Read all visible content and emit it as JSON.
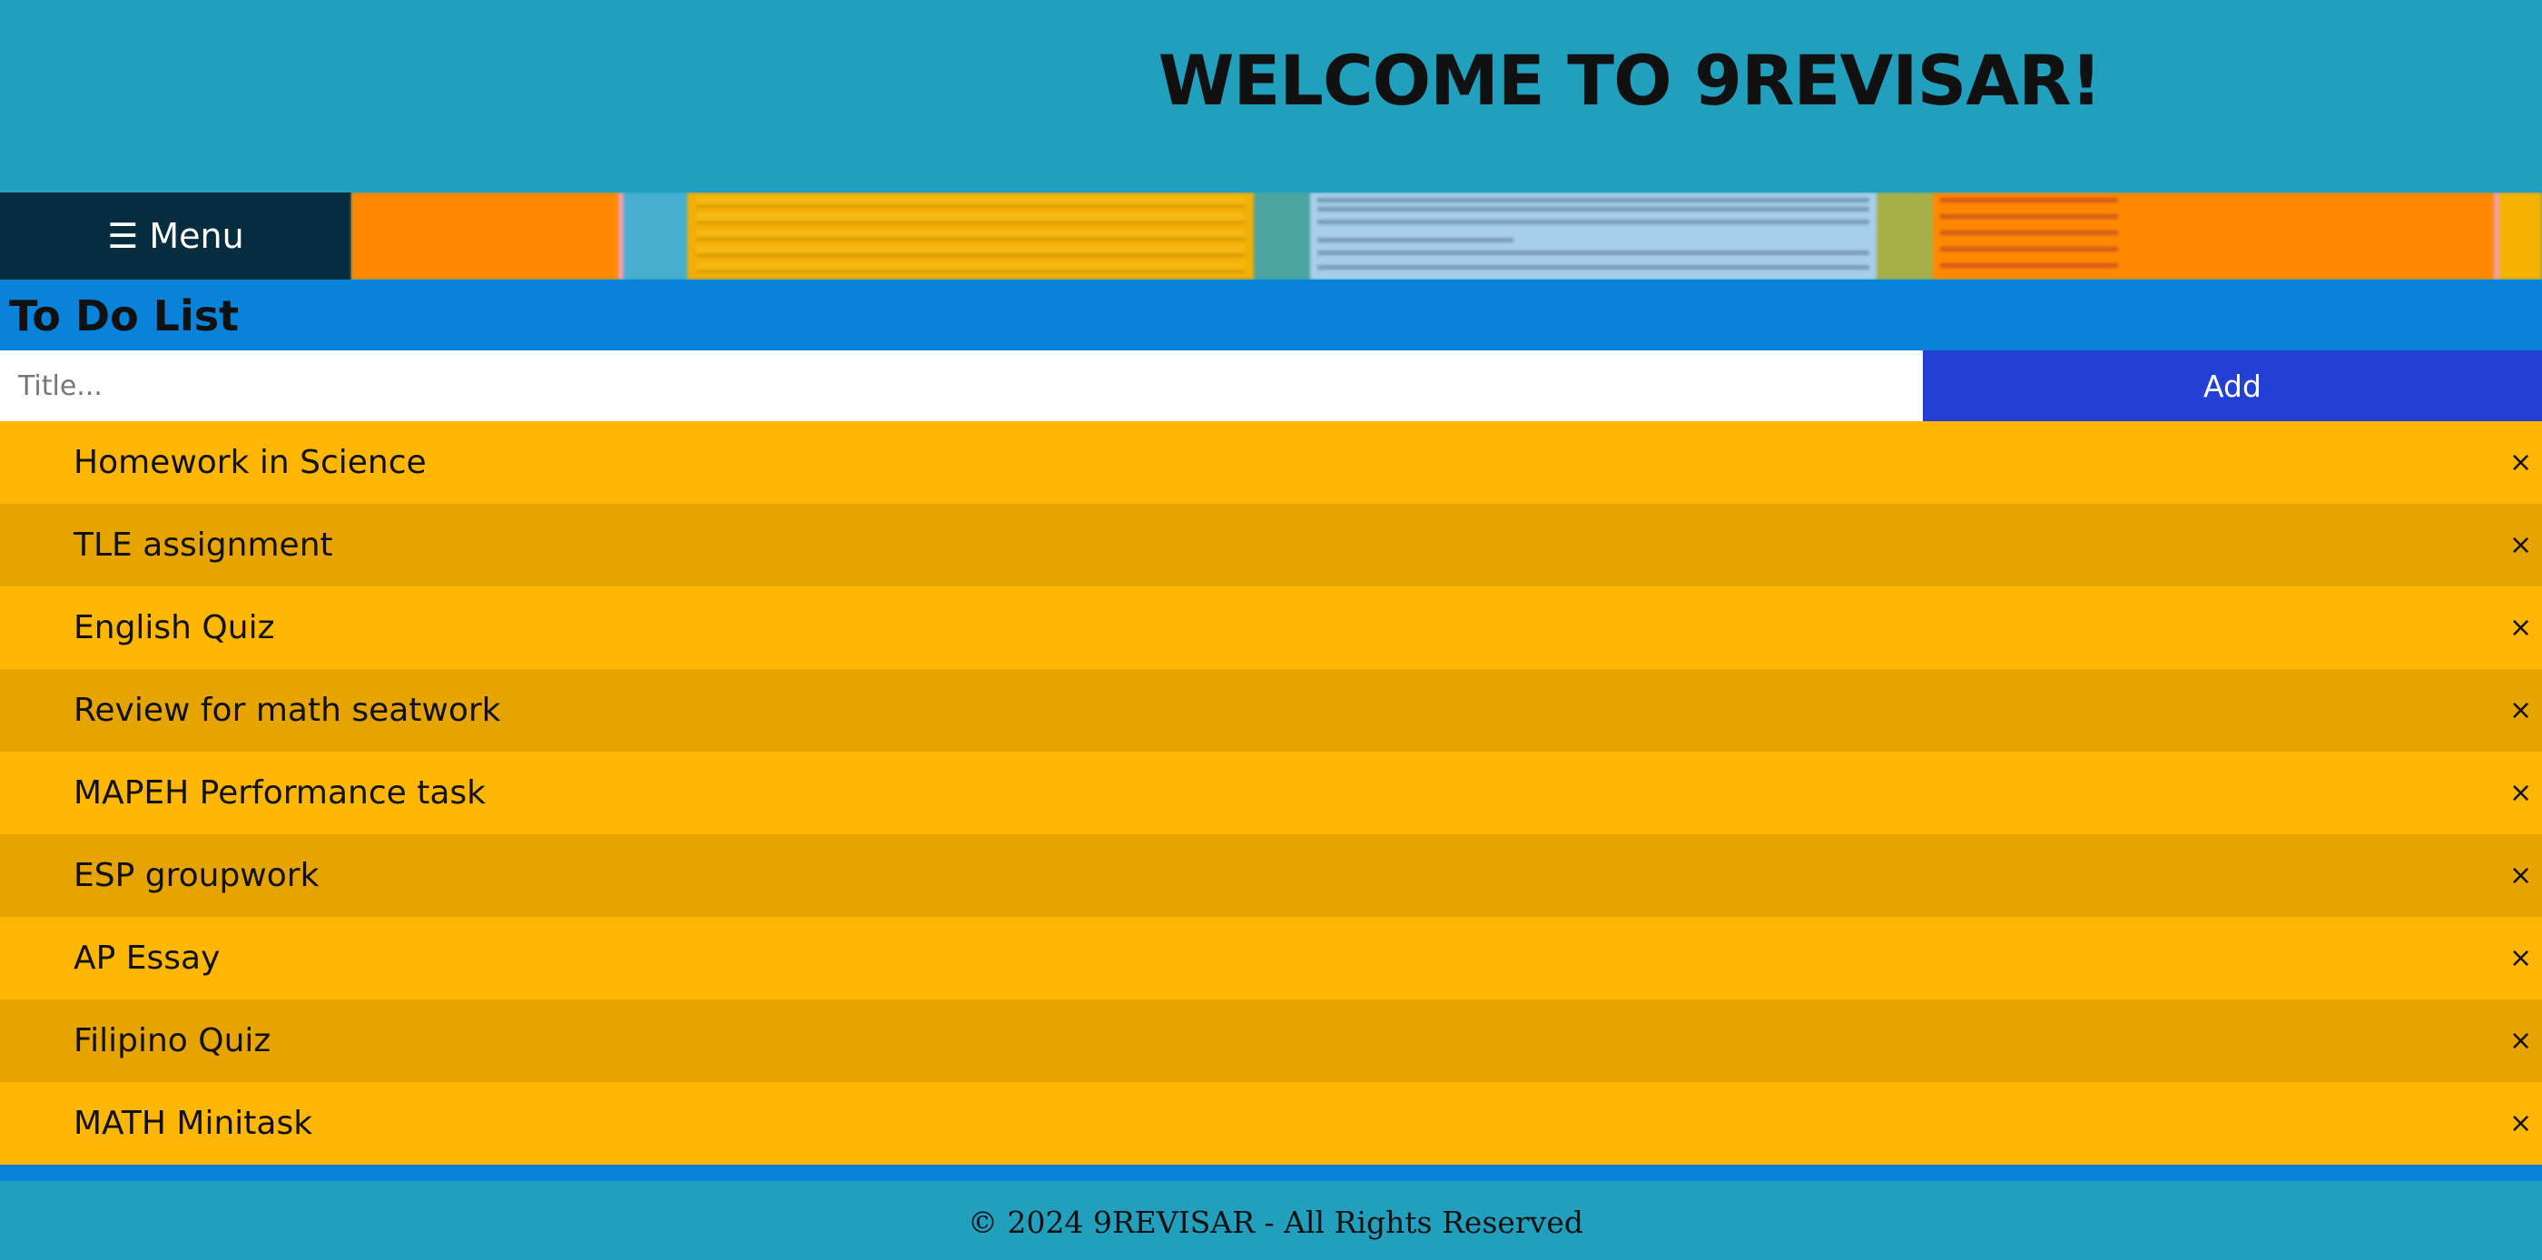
{
  "header": {
    "title": "WELCOME TO 9REVISAR!"
  },
  "nav": {
    "menu_label": "☰ Menu"
  },
  "todo": {
    "heading": "To Do List",
    "input_placeholder": "Title...",
    "input_value": "",
    "add_label": "Add",
    "close_glyph": "×",
    "items": [
      {
        "text": "Homework in Science"
      },
      {
        "text": "TLE assignment"
      },
      {
        "text": "English Quiz"
      },
      {
        "text": "Review for math seatwork"
      },
      {
        "text": "MAPEH Performance task"
      },
      {
        "text": "ESP groupwork"
      },
      {
        "text": "AP Essay"
      },
      {
        "text": "Filipino Quiz"
      },
      {
        "text": "MATH Minitask"
      }
    ]
  },
  "footer": {
    "text": "© 2024 9REVISAR - All Rights Reserved"
  },
  "colors": {
    "header_bg": "#229fbd",
    "menu_bg": "#062c40",
    "todo_header_bg": "#0883d9",
    "add_button_bg": "#2240d3",
    "item_bg": "#ffb703",
    "item_bg_alt": "#e5a400"
  },
  "icons": {
    "menu": "hamburger-icon",
    "delete": "close-icon"
  }
}
